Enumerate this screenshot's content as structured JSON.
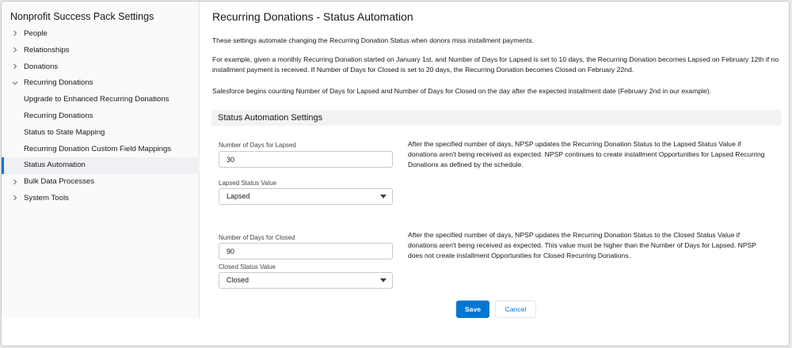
{
  "sidebar": {
    "title": "Nonprofit Success Pack Settings",
    "items": [
      {
        "label": "People",
        "level": "top",
        "expanded": false
      },
      {
        "label": "Relationships",
        "level": "top",
        "expanded": false
      },
      {
        "label": "Donations",
        "level": "top",
        "expanded": false
      },
      {
        "label": "Recurring Donations",
        "level": "top",
        "expanded": true
      },
      {
        "label": "Upgrade to Enhanced Recurring Donations",
        "level": "sub"
      },
      {
        "label": "Recurring Donations",
        "level": "sub"
      },
      {
        "label": "Status to State Mapping",
        "level": "sub"
      },
      {
        "label": "Recurring Donation Custom Field Mappings",
        "level": "sub"
      },
      {
        "label": "Status Automation",
        "level": "sub",
        "active": true
      },
      {
        "label": "Bulk Data Processes",
        "level": "top",
        "expanded": false
      },
      {
        "label": "System Tools",
        "level": "top",
        "expanded": false
      }
    ]
  },
  "main": {
    "title": "Recurring Donations - Status Automation",
    "intro": "These settings automate changing the Recurring Donation Status when donors miss installment payments.",
    "example": "For example, given a monthly Recurring Donation started on January 1st, and Number of Days for Lapsed is set to 10 days, the Recurring Donation becomes Lapsed on February 12th if no installment payment is received. If Number of Days for Closed is set to 20 days, the Recurring Donation becomes Closed on February 22nd.",
    "counting": "Salesforce begins counting Number of Days for Lapsed and Number of Days for Closed on the day after the expected installment date (February 2nd in our example).",
    "section_title": "Status Automation Settings",
    "lapsed_days_label": "Number of Days for Lapsed",
    "lapsed_days_value": "30",
    "lapsed_status_label": "Lapsed Status Value",
    "lapsed_status_value": "Lapsed",
    "lapsed_help": "After the specified number of days, NPSP updates the Recurring Donation Status to the Lapsed Status Value if donations aren't being received as expected. NPSP continues to create installment Opportunities for Lapsed Recurring Donations as defined by the schedule.",
    "closed_days_label": "Number of Days for Closed",
    "closed_days_value": "90",
    "closed_status_label": "Closed Status Value",
    "closed_status_value": "Closed",
    "closed_help": "After the specified number of days, NPSP updates the Recurring Donation Status to the Closed Status Value if donations aren't being received as expected. This value must be higher than the Number of Days for Lapsed. NPSP does not create installment Opportunities for Closed Recurring Donations.",
    "save_label": "Save",
    "cancel_label": "Cancel"
  },
  "colors": {
    "brand": "#0176d3",
    "active_bg": "#eef0f3",
    "section_bg": "#f3f3f3"
  }
}
